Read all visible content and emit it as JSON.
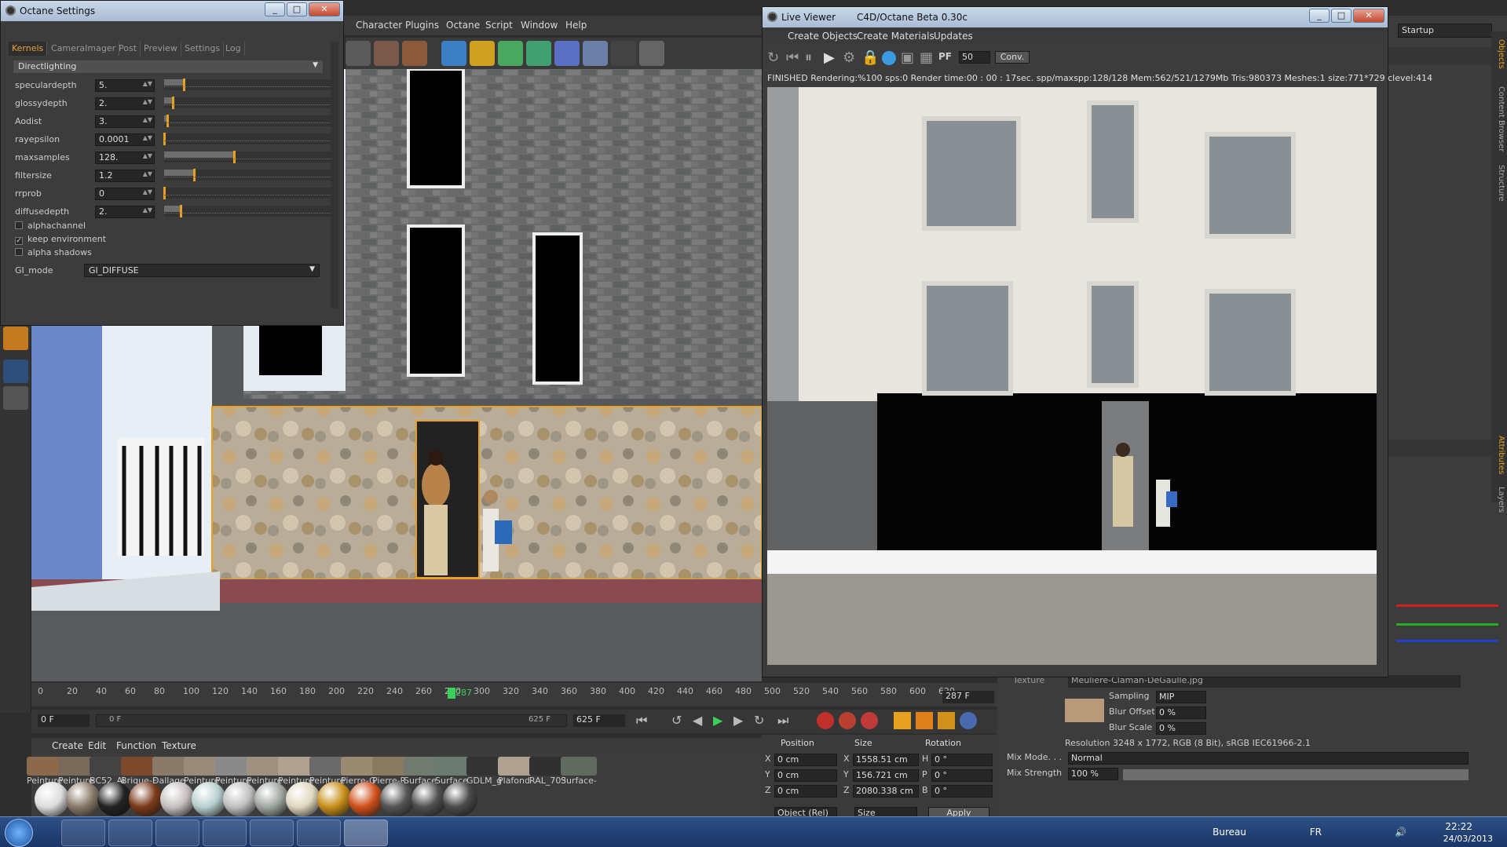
{
  "c4d": {
    "menu": [
      "Character",
      "Plugins",
      "Octane",
      "Script",
      "Window",
      "Help"
    ],
    "layout_label": "Startup"
  },
  "octane_settings": {
    "title": "Octane Settings",
    "tabs": [
      "Kernels",
      "CameraImager",
      "Post",
      "Preview",
      "Settings",
      "Log"
    ],
    "section": "Directlighting",
    "params": [
      {
        "label": "speculardepth",
        "value": "5.",
        "level": 0.12
      },
      {
        "label": "glossydepth",
        "value": "2.",
        "level": 0.05
      },
      {
        "label": "Aodist",
        "value": "3.",
        "level": 0.02
      },
      {
        "label": "rayepsilon",
        "value": "0.0001",
        "level": 0.0
      },
      {
        "label": "maxsamples",
        "value": "128.",
        "level": 0.42
      },
      {
        "label": "filtersize",
        "value": "1.2",
        "level": 0.18
      },
      {
        "label": "rrprob",
        "value": "0",
        "level": 0.0
      },
      {
        "label": "diffusedepth",
        "value": "2.",
        "level": 0.1
      }
    ],
    "checkboxes": [
      {
        "label": "alphachannel",
        "checked": false
      },
      {
        "label": "keep environment",
        "checked": true
      },
      {
        "label": "alpha shadows",
        "checked": false
      }
    ],
    "gi_mode_label": "GI_mode",
    "gi_mode_value": "GI_DIFFUSE"
  },
  "live_viewer": {
    "title": "Live Viewer",
    "subtitle": "C4D/Octane Beta 0.30c",
    "menu": [
      "Create Objects",
      "Create Materials",
      "Updates"
    ],
    "samples_field": "50",
    "conv_button": "Conv.",
    "status": "FINISHED Rendering:%100 sps:0 Render time:00 : 00 : 17sec. spp/maxspp:128/128 Mem:562/521/1279Mb Tris:980373 Meshes:1 size:771*729 clevel:414"
  },
  "timeline": {
    "ticks": [
      "0",
      "20",
      "40",
      "60",
      "80",
      "100",
      "120",
      "140",
      "160",
      "180",
      "200",
      "220",
      "240",
      "260",
      "280",
      "300",
      "320",
      "340",
      "360",
      "380",
      "400",
      "420",
      "440",
      "460",
      "480",
      "500",
      "520",
      "540",
      "560",
      "580",
      "600",
      "620"
    ],
    "current_frame": "287",
    "frame_field": "287 F",
    "start_field": "0 F",
    "range_start": "0 F",
    "range_end": "625 F",
    "end_field": "625 F"
  },
  "materials": {
    "menu": [
      "Create",
      "Edit",
      "Function",
      "Texture"
    ],
    "names": [
      "Peinture",
      "Peinture",
      "BC52_Ai",
      "Brique-F",
      "Dallage",
      "Peinture",
      "Peinture",
      "Peinture",
      "Peinture",
      "Peinture",
      "Pierre-G",
      "Pierre-R",
      "Surface",
      "Surface",
      "GDLM_g",
      "Plafond",
      "RAL_703",
      "Surface-"
    ]
  },
  "coordinates": {
    "headers": [
      "Position",
      "Size",
      "Rotation"
    ],
    "rows": [
      {
        "axis": "X",
        "pos": "0 cm",
        "saxis": "X",
        "size": "1558.51 cm",
        "raxis": "H",
        "rot": "0 °"
      },
      {
        "axis": "Y",
        "pos": "0 cm",
        "saxis": "Y",
        "size": "156.721 cm",
        "raxis": "P",
        "rot": "0 °"
      },
      {
        "axis": "Z",
        "pos": "0 cm",
        "saxis": "Z",
        "size": "2080.338 cm",
        "raxis": "B",
        "rot": "0 °"
      }
    ],
    "mode": "Object (Rel)",
    "size_mode": "Size",
    "apply": "Apply"
  },
  "attributes": {
    "texture_label": "Texture",
    "texture_file": "Meuliere-Claman-DeGaulle.jpg",
    "sampling_label": "Sampling",
    "sampling_value": "MIP",
    "blur_offset_label": "Blur Offset",
    "blur_offset_value": "0 %",
    "blur_scale_label": "Blur Scale",
    "blur_scale_value": "0 %",
    "resolution": "Resolution 3248 x 1772, RGB (8 Bit), sRGB IEC61966-2.1",
    "mix_mode_label": "Mix Mode. . .",
    "mix_mode_value": "Normal",
    "mix_strength_label": "Mix Strength",
    "mix_strength_value": "100 %"
  },
  "right_tabs": [
    "Objects",
    "Content Browser",
    "Structure",
    "Attributes",
    "Layers"
  ],
  "taskbar": {
    "desktop_label": "Bureau",
    "lang": "FR",
    "time": "22:22",
    "date": "24/03/2013"
  },
  "colors": {
    "accent": "#e8a020",
    "title_bar": "#b8cbe0",
    "taskbar": "#1f3d70"
  }
}
